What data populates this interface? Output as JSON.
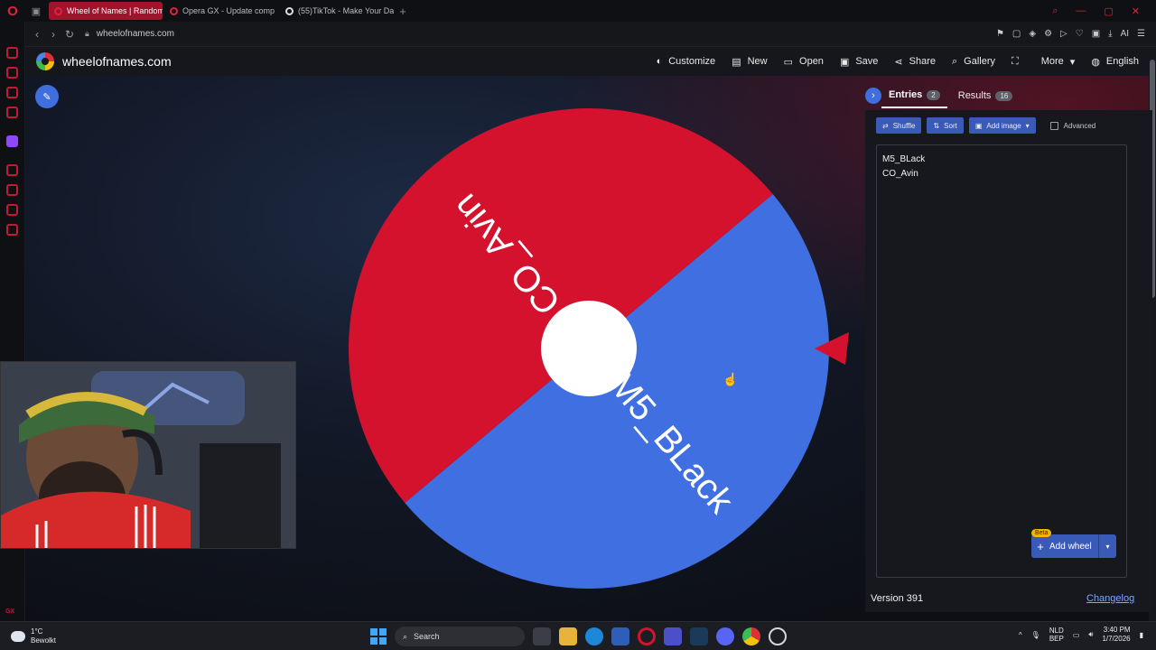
{
  "browser": {
    "tabs": [
      {
        "label": "Wheel of Names | Random",
        "active": true
      },
      {
        "label": "Opera GX - Update comp",
        "active": false
      },
      {
        "label": "(55)TikTok - Make Your Da",
        "active": false
      }
    ],
    "url": "wheelofnames.com"
  },
  "site": {
    "name": "wheelofnames.com",
    "menu": [
      {
        "label": "Customize",
        "icon": "palette-icon",
        "glyph": "◐"
      },
      {
        "label": "New",
        "icon": "file-icon",
        "glyph": "▤"
      },
      {
        "label": "Open",
        "icon": "folder-icon",
        "glyph": "▭"
      },
      {
        "label": "Save",
        "icon": "save-icon",
        "glyph": "▣"
      },
      {
        "label": "Share",
        "icon": "share-icon",
        "glyph": "⋖"
      },
      {
        "label": "Gallery",
        "icon": "search-icon",
        "glyph": "⌕"
      },
      {
        "label": "",
        "icon": "fullscreen-icon",
        "glyph": "⛶"
      },
      {
        "label": "More",
        "icon": "chevron-down-icon",
        "glyph": "▾"
      },
      {
        "label": "English",
        "icon": "globe-icon",
        "glyph": "◍"
      }
    ]
  },
  "wheel": {
    "segments": [
      {
        "label": "M5_BLack",
        "color": "#3f6fe0"
      },
      {
        "label": "CO_Avin",
        "color": "#d4122e"
      }
    ],
    "pointer_color": "#d4122e"
  },
  "panel": {
    "tabs": [
      {
        "label": "Entries",
        "count": "2"
      },
      {
        "label": "Results",
        "count": "16"
      }
    ],
    "toolbar": {
      "shuffle": "Shuffle",
      "sort": "Sort",
      "add_image": "Add image",
      "advanced": "Advanced"
    },
    "entries": [
      "M5_BLack",
      "CO_Avin"
    ],
    "add_wheel": "Add wheel",
    "beta": "Beta"
  },
  "footer": {
    "version": "Version 391",
    "changelog": "Changelog"
  },
  "taskbar": {
    "weather_temp": "1°C",
    "weather_desc": "Bewolkt",
    "search": "Search",
    "lang_top": "NLD",
    "lang_bottom": "BEP",
    "time": "3:40 PM",
    "date": "1/7/2026"
  },
  "colors": {
    "accent": "#3a5ab8",
    "brand_red": "#d4122e",
    "wheel_blue": "#3f6fe0"
  }
}
